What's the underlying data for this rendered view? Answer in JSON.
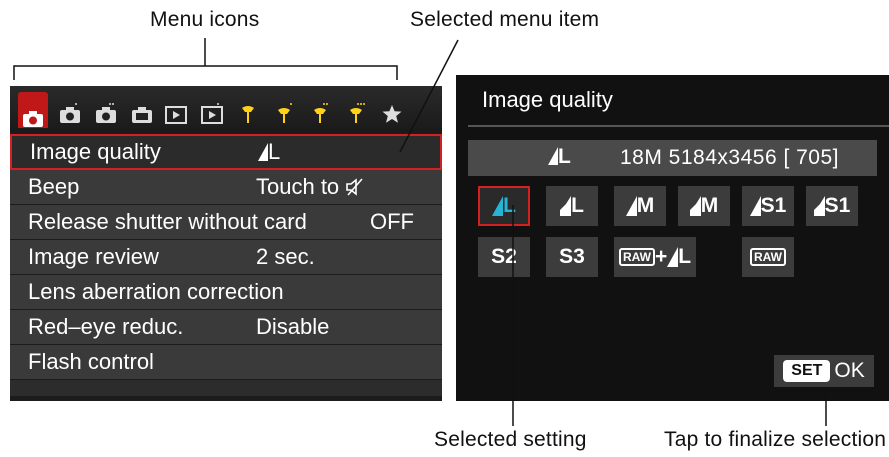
{
  "callouts": {
    "menu_icons": "Menu icons",
    "selected_menu_item": "Selected menu item",
    "selected_setting": "Selected setting",
    "tap_finalize": "Tap to finalize selection"
  },
  "menu": {
    "tabs": [
      {
        "icon": "camera-icon",
        "active": true
      },
      {
        "icon": "camera-icon",
        "active": false
      },
      {
        "icon": "camera-icon",
        "active": false
      },
      {
        "icon": "camera-icon",
        "active": false
      },
      {
        "icon": "playback-icon",
        "active": false
      },
      {
        "icon": "playback-icon",
        "active": false
      },
      {
        "icon": "wrench-icon",
        "active": false
      },
      {
        "icon": "wrench-icon",
        "active": false
      },
      {
        "icon": "wrench-icon",
        "active": false
      },
      {
        "icon": "wrench-icon",
        "active": false
      },
      {
        "icon": "star-icon",
        "active": false
      }
    ],
    "items": [
      {
        "label": "Image quality",
        "value": "L",
        "value_icon": "quality-fine-icon",
        "selected": true
      },
      {
        "label": "Beep",
        "value": "Touch to",
        "value_icon": "speaker-mute-icon",
        "selected": false
      },
      {
        "label": "Release shutter without card",
        "value": "OFF",
        "selected": false
      },
      {
        "label": "Image review",
        "value": "2 sec.",
        "selected": false
      },
      {
        "label": "Lens aberration correction",
        "value": "",
        "selected": false
      },
      {
        "label": "Red–eye reduc.",
        "value": "Disable",
        "selected": false
      },
      {
        "label": "Flash control",
        "value": "",
        "selected": false
      }
    ]
  },
  "quality_screen": {
    "title": "Image quality",
    "current_quality": "L",
    "current_detail": "18M 5184x3456 [ 705]",
    "options": [
      {
        "label": "L",
        "icon": "fine-icon",
        "selected": true
      },
      {
        "label": "L",
        "icon": "normal-icon",
        "selected": false
      },
      {
        "label": "M",
        "icon": "fine-icon",
        "selected": false
      },
      {
        "label": "M",
        "icon": "normal-icon",
        "selected": false
      },
      {
        "label": "S1",
        "icon": "fine-icon",
        "selected": false
      },
      {
        "label": "S1",
        "icon": "normal-icon",
        "selected": false
      },
      {
        "label": "S2",
        "selected": false
      },
      {
        "label": "S3",
        "selected": false
      },
      {
        "label": "L",
        "raw_prefix": "RAW",
        "plus": "+",
        "icon": "fine-icon",
        "selected": false
      },
      {
        "label": "RAW",
        "selected": false
      }
    ],
    "set_label": "SET",
    "ok_label": "OK"
  },
  "colors": {
    "highlight_red": "#d42020",
    "selected_cyan": "#27b3d6",
    "row_gray": "#3a3a3a"
  }
}
